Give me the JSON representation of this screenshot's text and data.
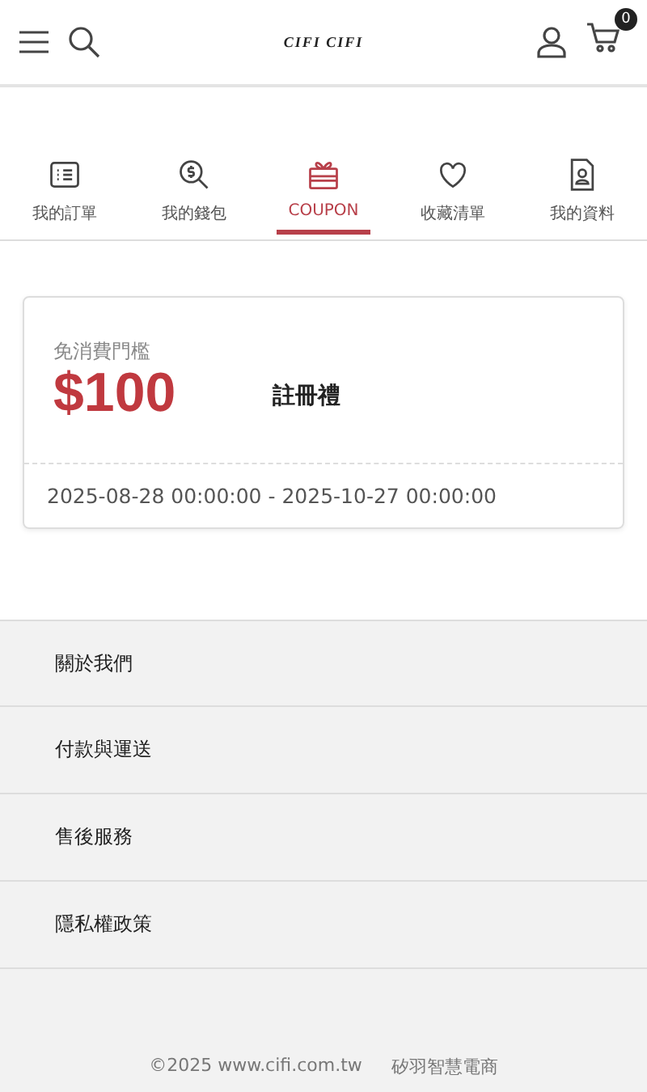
{
  "header": {
    "logo": "CIFI CIFI",
    "cart_count": "0"
  },
  "tabs": [
    {
      "label": "我的訂單",
      "selected": false
    },
    {
      "label": "我的錢包",
      "selected": false
    },
    {
      "label": "COUPON",
      "selected": true
    },
    {
      "label": "收藏清單",
      "selected": false
    },
    {
      "label": "我的資料",
      "selected": false
    }
  ],
  "coupons": [
    {
      "threshold": "免消費門檻",
      "amount": "$100",
      "name": "註冊禮",
      "period": "2025-08-28 00:00:00 - 2025-10-27 00:00:00"
    }
  ],
  "menu": [
    "關於我們",
    "付款與運送",
    "售後服務",
    "隱私權政策"
  ],
  "footer": {
    "copyright": "©2025 www.cifi.com.tw",
    "company": "矽羽智慧電商"
  }
}
